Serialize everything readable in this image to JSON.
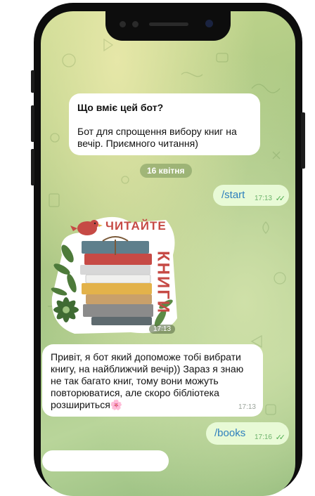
{
  "bot_info": {
    "title": "Що вміє цей бот?",
    "body": "Бот для спрощення вибору книг на вечір. Приємного читання)"
  },
  "date_badge": "16 квітня",
  "messages": [
    {
      "type": "outgoing",
      "text": "/start",
      "time": "17:13",
      "status": "✓✓"
    },
    {
      "type": "sticker",
      "caption_words": [
        "ЧИТАЙТЕ",
        "КНИГИ"
      ],
      "time": "17:13"
    },
    {
      "type": "incoming",
      "text": "Привіт, я бот який допоможе тобі вибрати книгу, на найближчий вечір)) Зараз я знаю не так багато книг, тому вони можуть повторюватися, але скоро бібліотека розшириться🌸",
      "time": "17:13"
    },
    {
      "type": "outgoing",
      "text": "/books",
      "time": "17:16",
      "status": "✓✓"
    }
  ],
  "colors": {
    "outgoing_bubble": "#e8fad6",
    "incoming_bubble": "#ffffff",
    "command_link": "#2d7fbd",
    "read_check": "#4fae4e"
  }
}
